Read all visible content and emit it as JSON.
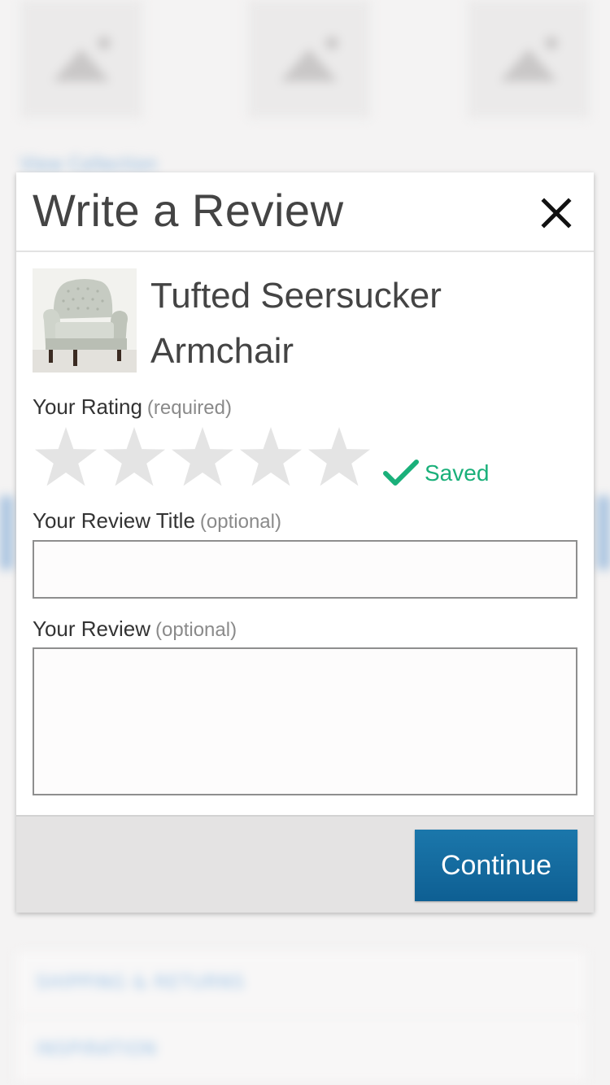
{
  "background": {
    "link_text": "View Collection",
    "rows": [
      "SHIPPING & RETURNS",
      "INSPIRATION"
    ]
  },
  "modal": {
    "title": "Write a Review",
    "close_icon": "close-icon",
    "product": {
      "name_line1": "Tufted Seersucker",
      "name_line2": "Armchair",
      "image_icon": "armchair-image"
    },
    "rating": {
      "label": "Your Rating",
      "hint": "(required)",
      "max_stars": 5,
      "selected_stars": 0,
      "star_color": "#e4e4e4",
      "saved_label": "Saved",
      "saved_color": "#1ab07a"
    },
    "review_title": {
      "label": "Your Review Title",
      "hint": "(optional)",
      "value": "",
      "placeholder": ""
    },
    "review_body": {
      "label": "Your Review",
      "hint": "(optional)",
      "value": "",
      "placeholder": ""
    },
    "continue_label": "Continue",
    "accent_color": "#1b6fa3"
  }
}
